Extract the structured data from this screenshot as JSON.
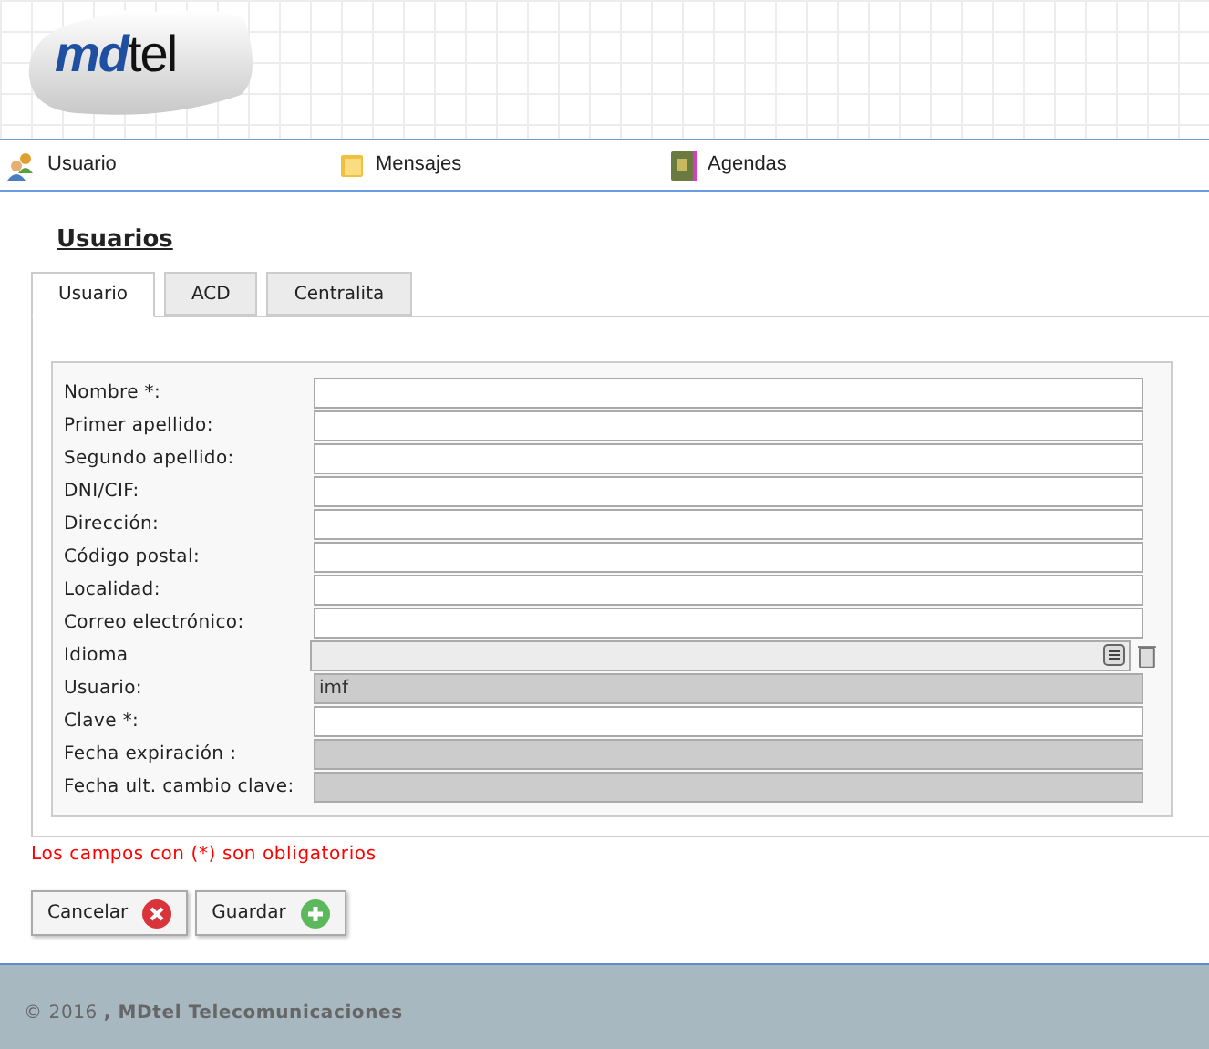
{
  "logo": "**md**tel",
  "nav": [
    {
      "label": "Usuario",
      "kind": "users"
    },
    {
      "label": "Mensajes",
      "kind": "folder"
    },
    {
      "label": "Agendas",
      "kind": "book"
    }
  ],
  "title": "Usuarios",
  "tabs": [
    {
      "label": "Usuario",
      "selected": true
    },
    {
      "label": "ACD",
      "selected": false
    },
    {
      "label": "Centralita",
      "selected": false
    }
  ],
  "fields": [
    {
      "label": "Nombre *:",
      "kind": "text"
    },
    {
      "label": "Primer apellido:",
      "kind": "text"
    },
    {
      "label": "Segundo apellido:",
      "kind": "text"
    },
    {
      "label": "DNI/CIF:",
      "kind": "text"
    },
    {
      "label": "Dirección:",
      "kind": "text"
    },
    {
      "label": "Código postal:",
      "kind": "text"
    },
    {
      "label": "Localidad:",
      "kind": "text"
    },
    {
      "label": "Correo electrónico:",
      "kind": "text"
    },
    {
      "label": "Idioma",
      "kind": "select"
    },
    {
      "label": "Usuario:",
      "kind": "readonly",
      "value": "imf"
    },
    {
      "label": "Clave *:",
      "kind": "text"
    },
    {
      "label": "Fecha expiración :",
      "kind": "readonly"
    },
    {
      "label": "Fecha ult. cambio clave:",
      "kind": "readonly"
    }
  ],
  "required_note": "Los campos con (*) son obligatorios",
  "buttons": [
    {
      "label": "Cancelar",
      "kind": "cancel"
    },
    {
      "label": "Guardar",
      "kind": "save"
    }
  ],
  "footer": "© 2016 **, MDtel Telecomunicaciones**"
}
